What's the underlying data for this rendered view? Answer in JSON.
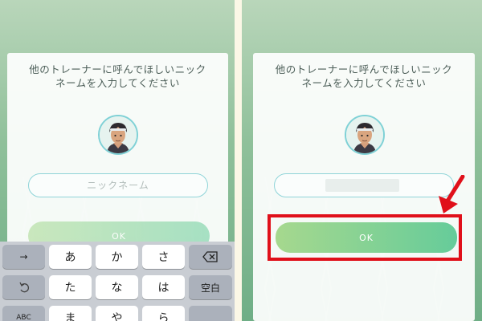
{
  "left": {
    "dialog": {
      "prompt_line1": "他のトレーナーに呼んでほしいニック",
      "prompt_line2": "ネームを入力してください",
      "nickname_placeholder": "ニックネーム",
      "ok_label": "OK"
    },
    "keyboard": {
      "row1": [
        "→",
        "あ",
        "か",
        "さ",
        "⌫"
      ],
      "row2": [
        "↺",
        "た",
        "な",
        "は",
        "空白"
      ],
      "row3": [
        "ABC",
        "ま",
        "や",
        "ら",
        ""
      ]
    }
  },
  "right": {
    "dialog": {
      "prompt_line1": "他のトレーナーに呼んでほしいニック",
      "prompt_line2": "ネームを入力してください",
      "ok_label": "OK"
    }
  },
  "colors": {
    "highlight": "#e0101a",
    "button_gradient_start": "#a6d88e",
    "button_gradient_end": "#66cc9a",
    "input_border": "#8fd4d8"
  },
  "icons": [
    "trainer-avatar-icon",
    "backspace-icon",
    "undo-icon",
    "red-arrow-icon"
  ]
}
